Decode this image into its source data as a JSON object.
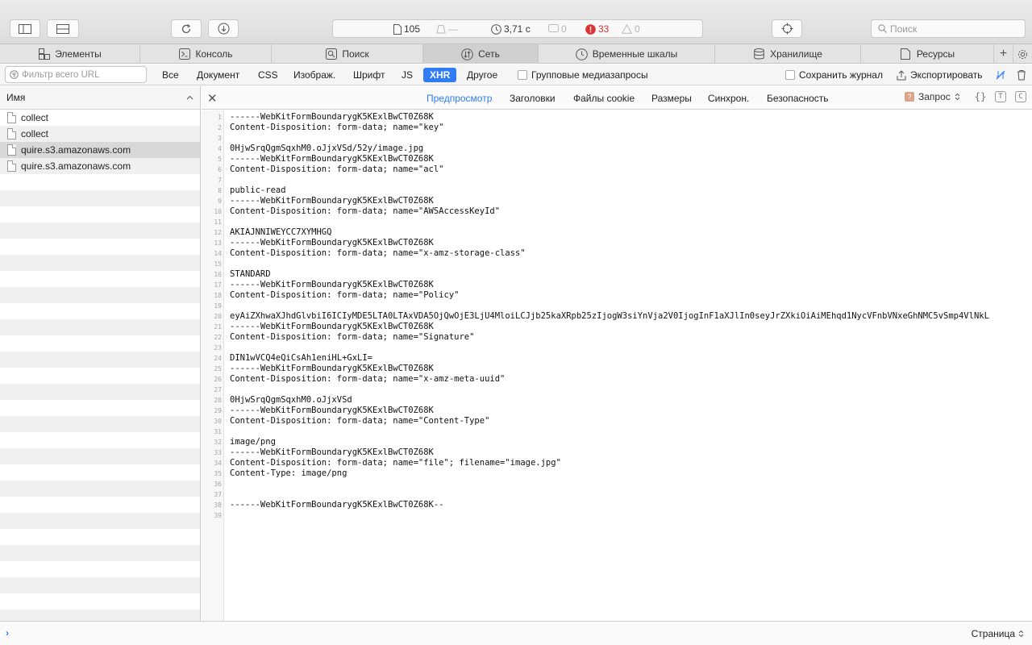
{
  "toolbar": {
    "resources_count": "105",
    "resources_size": "—",
    "load_time": "3,71 с",
    "messages_count": "0",
    "errors_count": "33",
    "warnings_count": "0",
    "search_placeholder": "Поиск"
  },
  "tabs": [
    {
      "label": "Элементы",
      "icon": "elements-icon"
    },
    {
      "label": "Консоль",
      "icon": "console-icon"
    },
    {
      "label": "Поиск",
      "icon": "search-icon"
    },
    {
      "label": "Сеть",
      "icon": "network-icon"
    },
    {
      "label": "Временные шкалы",
      "icon": "timeline-icon"
    },
    {
      "label": "Хранилище",
      "icon": "storage-icon"
    },
    {
      "label": "Ресурсы",
      "icon": "resources-icon"
    }
  ],
  "filter": {
    "placeholder": "Фильтр всего URL",
    "types": [
      "Все",
      "Документ",
      "CSS",
      "Изображ.",
      "Шрифт",
      "JS",
      "XHR",
      "Другое"
    ],
    "active_type": "XHR",
    "group_media": "Групповые медиазапросы",
    "preserve_log": "Сохранить журнал",
    "export": "Экспортировать"
  },
  "list": {
    "header": "Имя",
    "items": [
      {
        "name": "collect"
      },
      {
        "name": "collect"
      },
      {
        "name": "quire.s3.amazonaws.com"
      },
      {
        "name": "quire.s3.amazonaws.com"
      }
    ]
  },
  "detail": {
    "tabs": [
      "Предпросмотр",
      "Заголовки",
      "Файлы cookie",
      "Размеры",
      "Синхрон.",
      "Безопасность"
    ],
    "active_tab": "Предпросмотр",
    "request_selector": "Запрос",
    "lines": [
      "------WebKitFormBoundarygK5KExlBwCT0Z68K",
      "Content-Disposition: form-data; name=\"key\"",
      "",
      "0HjwSrqQgmSqxhM0.oJjxVSd/52y/image.jpg",
      "------WebKitFormBoundarygK5KExlBwCT0Z68K",
      "Content-Disposition: form-data; name=\"acl\"",
      "",
      "public-read",
      "------WebKitFormBoundarygK5KExlBwCT0Z68K",
      "Content-Disposition: form-data; name=\"AWSAccessKeyId\"",
      "",
      "AKIAJNNIWEYCC7XYMHGQ",
      "------WebKitFormBoundarygK5KExlBwCT0Z68K",
      "Content-Disposition: form-data; name=\"x-amz-storage-class\"",
      "",
      "STANDARD",
      "------WebKitFormBoundarygK5KExlBwCT0Z68K",
      "Content-Disposition: form-data; name=\"Policy\"",
      "",
      "eyAiZXhwaXJhdGlvbiI6ICIyMDE5LTA0LTAxVDA5OjQwOjE3LjU4MloiLCJjb25kaXRpb25zIjogW3siYnVja2V0IjogInF1aXJlIn0seyJrZXkiOiAiMEhqd1NycVFnbVNxeGhNMC5vSmp4VlNkL",
      "------WebKitFormBoundarygK5KExlBwCT0Z68K",
      "Content-Disposition: form-data; name=\"Signature\"",
      "",
      "DIN1wVCQ4eQiCsAh1eniHL+GxLI=",
      "------WebKitFormBoundarygK5KExlBwCT0Z68K",
      "Content-Disposition: form-data; name=\"x-amz-meta-uuid\"",
      "",
      "0HjwSrqQgmSqxhM0.oJjxVSd",
      "------WebKitFormBoundarygK5KExlBwCT0Z68K",
      "Content-Disposition: form-data; name=\"Content-Type\"",
      "",
      "image/png",
      "------WebKitFormBoundarygK5KExlBwCT0Z68K",
      "Content-Disposition: form-data; name=\"file\"; filename=\"image.jpg\"",
      "Content-Type: image/png",
      "",
      "",
      "------WebKitFormBoundarygK5KExlBwCT0Z68K--",
      ""
    ]
  },
  "bottom": {
    "prompt": "›",
    "page_selector": "Страница"
  }
}
